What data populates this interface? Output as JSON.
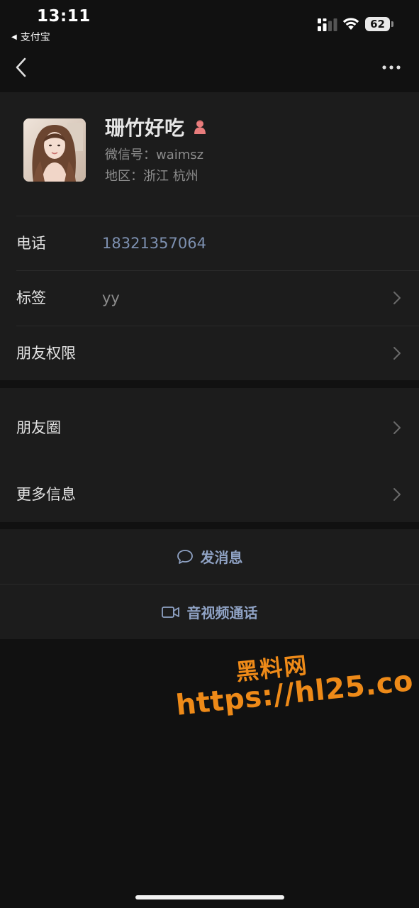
{
  "status_bar": {
    "time": "13:11",
    "back_app": "支付宝",
    "battery": "62"
  },
  "profile": {
    "name": "珊竹好吃",
    "wechat_id": "微信号：waimsz",
    "region": "地区：浙江 杭州",
    "gender": "female",
    "gender_color": "#e87c7c"
  },
  "rows": {
    "phone": {
      "label": "电话",
      "value": "18321357064"
    },
    "tags": {
      "label": "标签",
      "value": "yy"
    },
    "friend_permissions": {
      "label": "朋友权限"
    },
    "moments": {
      "label": "朋友圈"
    },
    "more_info": {
      "label": "更多信息"
    }
  },
  "actions": {
    "send_message": "发消息",
    "video_call": "音视频通话"
  },
  "watermark": {
    "title": "黑料网",
    "url": "https://hl25.co"
  },
  "colors": {
    "background": "#111111",
    "panel": "#1c1c1c",
    "link_blue": "#8fa2c4",
    "watermark_orange": "#ee8a18"
  },
  "icons": {
    "back": "chevron-left-icon",
    "more": "more-dots-icon",
    "chat": "chat-bubble-icon",
    "video": "video-camera-icon"
  }
}
